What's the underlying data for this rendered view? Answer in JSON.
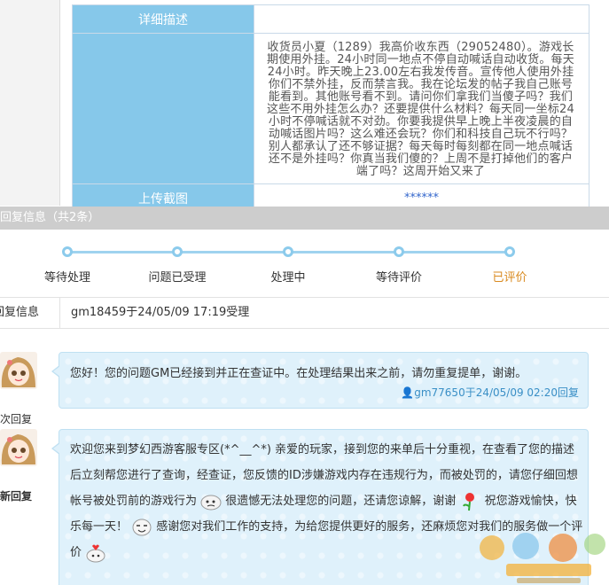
{
  "detail": {
    "desc_label": "详细描述",
    "desc_text": "收货员小夏（1289）我高价收东西（29052480）。游戏长期使用外挂。24小时同一地点不停自动喊话自动收货。每天24小时。昨天晚上23.00左右我发传音。宣传他人使用外挂你们不禁外挂，反而禁言我。我在论坛发的帖子我自己账号能看到。其他账号看不到。请问你们拿我们当傻子吗？我们这些不用外挂怎么办？还要提供什么材料？每天同一坐标24小时不停喊话就不对劲。你要我提供早上晚上半夜凌晨的自动喊话图片吗？这么难还会玩？你们和科技自己玩不行吗？别人都承认了还不够证据？每天每时每刻都在同一地点喊话还不是外挂吗？你真当我们傻的？上周不是打掉他们的客户端了吗？这周开始又来了",
    "upload_label": "上传截图",
    "upload_value": "******"
  },
  "reply": {
    "header": "回复信息",
    "count": "（共2条）",
    "info_label": "回复信息",
    "info_text": "gm18459于24/05/09 17:19受理"
  },
  "steps": [
    {
      "label": "等待处理"
    },
    {
      "label": "问题已受理"
    },
    {
      "label": "处理中"
    },
    {
      "label": "等待评价"
    },
    {
      "label": "已评价"
    }
  ],
  "replies": [
    {
      "side_caption": "次回复",
      "message": "您好！您的问题GM已经接到并正在查证中。在处理结果出来之前，请勿重复提单，谢谢。",
      "meta": "gm77650于24/05/09 02:20回复"
    },
    {
      "side_caption": "新回复",
      "part1": "欢迎您来到梦幻西游客服专区(*^__^*) 亲爱的玩家，接到您的来单后十分重视，在查看了您的描述后立刻帮您进行了查询，经查证，您反馈的ID涉嫌游戏内存在违规行为，而被处罚的，请您仔细回想帐号被处罚前的游戏行为",
      "part2": "很遗憾无法处理您的问题，还请您谅解，谢谢",
      "part3": "祝您游戏愉快，快乐每一天！",
      "part4": "感谢您对我们工作的支持，为给您提供更好的服务，还麻烦您对我们的服务做一个评价"
    }
  ],
  "colors": {
    "label_bg": "#86c8ea",
    "accent_orange": "#d98a1f",
    "link_blue": "#3a8fc6"
  }
}
